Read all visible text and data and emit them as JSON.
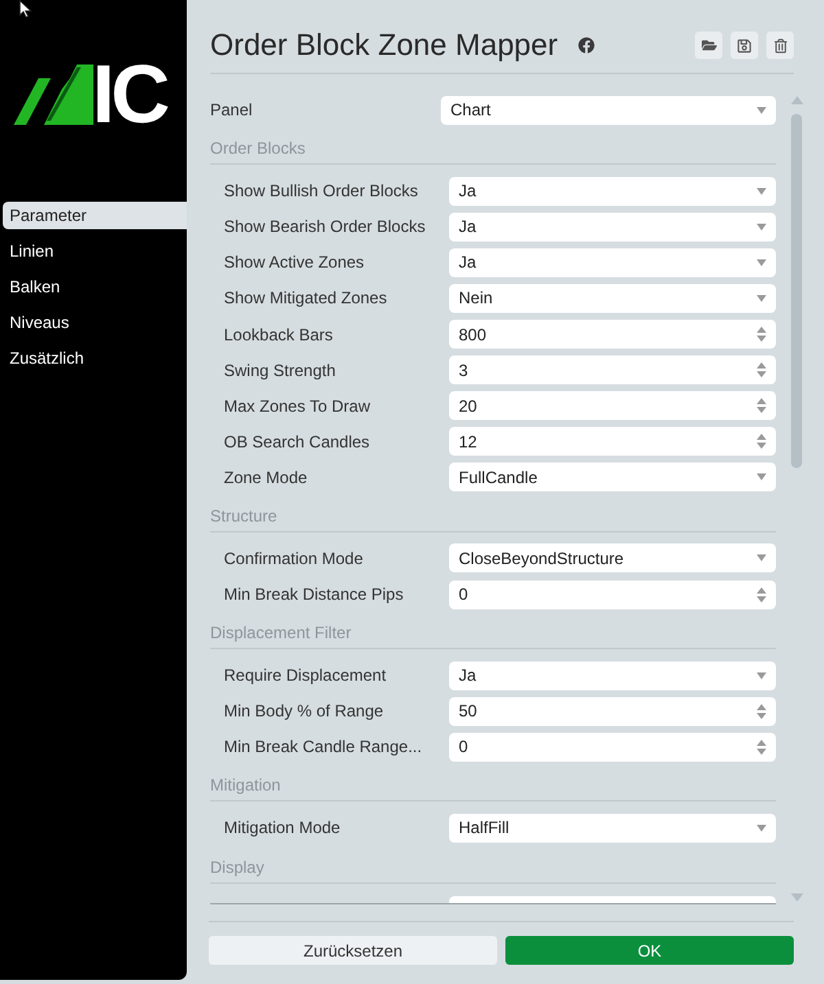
{
  "sidebar": {
    "logo": "IC",
    "items": [
      {
        "label": "Parameter",
        "selected": true
      },
      {
        "label": "Linien",
        "selected": false
      },
      {
        "label": "Balken",
        "selected": false
      },
      {
        "label": "Niveaus",
        "selected": false
      },
      {
        "label": "Zusätzlich",
        "selected": false
      }
    ]
  },
  "header": {
    "title": "Order Block Zone Mapper"
  },
  "panel": {
    "label": "Panel",
    "kind": "select",
    "value": "Chart"
  },
  "sections": [
    {
      "title": "Order Blocks",
      "fields": [
        {
          "label": "Show Bullish Order Blocks",
          "kind": "select",
          "value": "Ja"
        },
        {
          "label": "Show Bearish Order Blocks",
          "kind": "select",
          "value": "Ja"
        },
        {
          "label": "Show Active Zones",
          "kind": "select",
          "value": "Ja"
        },
        {
          "label": "Show Mitigated Zones",
          "kind": "select",
          "value": "Nein"
        },
        {
          "label": "Lookback Bars",
          "kind": "number",
          "value": "800"
        },
        {
          "label": "Swing Strength",
          "kind": "number",
          "value": "3"
        },
        {
          "label": "Max Zones To Draw",
          "kind": "number",
          "value": "20"
        },
        {
          "label": "OB Search Candles",
          "kind": "number",
          "value": "12"
        },
        {
          "label": "Zone Mode",
          "kind": "select",
          "value": "FullCandle"
        }
      ]
    },
    {
      "title": "Structure",
      "fields": [
        {
          "label": "Confirmation Mode",
          "kind": "select",
          "value": "CloseBeyondStructure"
        },
        {
          "label": "Min Break Distance Pips",
          "kind": "number",
          "value": "0"
        }
      ]
    },
    {
      "title": "Displacement Filter",
      "fields": [
        {
          "label": "Require Displacement",
          "kind": "select",
          "value": "Ja"
        },
        {
          "label": "Min Body % of Range",
          "kind": "number",
          "value": "50"
        },
        {
          "label": "Min Break Candle Range...",
          "kind": "number",
          "value": "0"
        }
      ]
    },
    {
      "title": "Mitigation",
      "fields": [
        {
          "label": "Mitigation Mode",
          "kind": "select",
          "value": "HalfFill"
        }
      ]
    },
    {
      "title": "Display",
      "fields": [
        {
          "clipped": true
        }
      ]
    }
  ],
  "buttons": [
    {
      "label": "Zurücksetzen",
      "kind": "secondary"
    },
    {
      "label": "OK",
      "kind": "primary"
    }
  ]
}
